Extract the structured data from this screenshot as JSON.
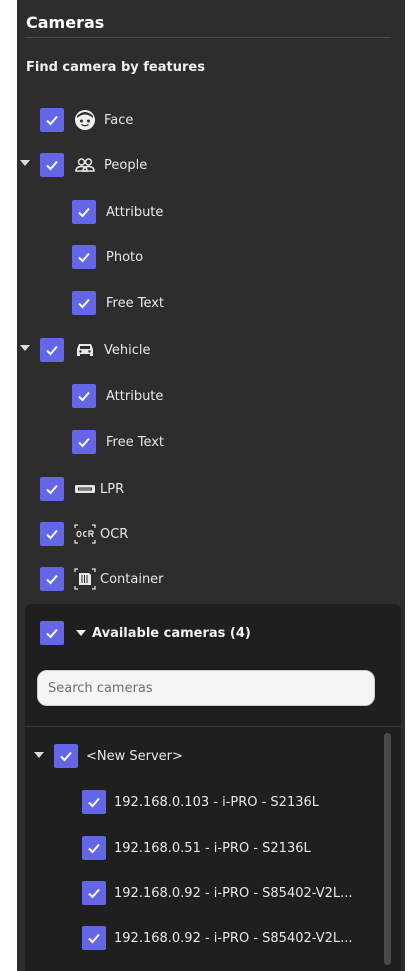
{
  "panel": {
    "title": "Cameras",
    "subtitle": "Find camera by features"
  },
  "features": [
    {
      "id": "face",
      "label": "Face",
      "icon": "face-icon",
      "checked": true
    },
    {
      "id": "people",
      "label": "People",
      "icon": "people-icon",
      "checked": true,
      "expanded": true,
      "children": [
        {
          "label": "Attribute",
          "checked": true
        },
        {
          "label": "Photo",
          "checked": true
        },
        {
          "label": "Free Text",
          "checked": true
        }
      ]
    },
    {
      "id": "vehicle",
      "label": "Vehicle",
      "icon": "vehicle-icon",
      "checked": true,
      "expanded": true,
      "children": [
        {
          "label": "Attribute",
          "checked": true
        },
        {
          "label": "Free Text",
          "checked": true
        }
      ]
    },
    {
      "id": "lpr",
      "label": "LPR",
      "icon": "license-plate-icon",
      "checked": true
    },
    {
      "id": "ocr",
      "label": "OCR",
      "icon": "ocr-icon",
      "checked": true
    },
    {
      "id": "container",
      "label": "Container",
      "icon": "container-icon",
      "checked": true
    }
  ],
  "available": {
    "title": "Available cameras (4)",
    "checked": true,
    "expanded": true,
    "search_placeholder": "Search cameras"
  },
  "server": {
    "label": "<New Server>",
    "checked": true,
    "expanded": true,
    "cameras": [
      {
        "label": "192.168.0.103 - i-PRO - S2136L",
        "checked": true
      },
      {
        "label": "192.168.0.51 - i-PRO - S2136L",
        "checked": true
      },
      {
        "label": "192.168.0.92 - i-PRO - S85402-V2L...",
        "checked": true
      },
      {
        "label": "192.168.0.92 - i-PRO - S85402-V2L...",
        "checked": true
      }
    ]
  },
  "colors": {
    "panel_bg": "#2d2d2d",
    "checkbox": "#6366e6",
    "inner_bg": "#1f1f1f"
  }
}
